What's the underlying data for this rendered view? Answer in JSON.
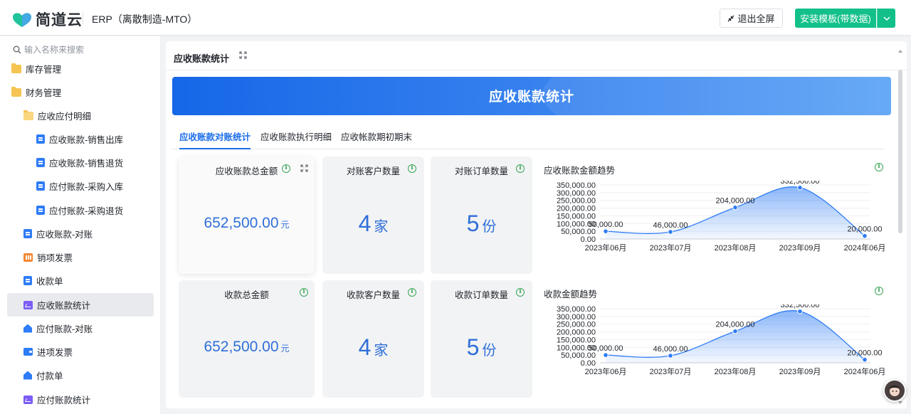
{
  "header": {
    "logo_text": "简道云",
    "app_title": "ERP（离散制造-MTO）",
    "exit_fullscreen": "退出全屏",
    "install_template": "安装模板(带数据)"
  },
  "sidebar": {
    "search_placeholder": "输入名称来搜索",
    "items": [
      {
        "label": "库存管理",
        "icon": "folder-icon"
      },
      {
        "label": "财务管理",
        "icon": "folder-open-icon"
      },
      {
        "label": "应收应付明细",
        "icon": "folder-open-icon"
      },
      {
        "label": "应收账款-销售出库",
        "icon": "form-icon"
      },
      {
        "label": "应收账款-销售退货",
        "icon": "form-icon"
      },
      {
        "label": "应付账款-采购入库",
        "icon": "form-icon"
      },
      {
        "label": "应付账款-采购退货",
        "icon": "form-icon"
      },
      {
        "label": "应收账款-对账",
        "icon": "form-icon"
      },
      {
        "label": "销项发票",
        "icon": "invoice-icon"
      },
      {
        "label": "收款单",
        "icon": "form-icon"
      },
      {
        "label": "应收账款统计",
        "icon": "chart-icon"
      },
      {
        "label": "应付账款-对账",
        "icon": "home-icon"
      },
      {
        "label": "进项发票",
        "icon": "wallet-icon"
      },
      {
        "label": "付款单",
        "icon": "home-icon"
      },
      {
        "label": "应付账款统计",
        "icon": "chart-icon"
      }
    ]
  },
  "main": {
    "title": "应收账款统计",
    "banner_title": "应收账款统计",
    "tabs": [
      "应收账款对账统计",
      "应收账款执行明细",
      "应收帐款期初期末"
    ],
    "kpis": [
      {
        "title": "应收账款总金额",
        "value": "652,500.00",
        "unit": "元"
      },
      {
        "title": "对账客户数量",
        "value": "4",
        "unit": "家"
      },
      {
        "title": "对账订单数量",
        "value": "5",
        "unit": "份"
      },
      {
        "title": "收款总金额",
        "value": "652,500.00",
        "unit": "元"
      },
      {
        "title": "收款客户数量",
        "value": "4",
        "unit": "家"
      },
      {
        "title": "收款订单数量",
        "value": "5",
        "unit": "份"
      }
    ]
  },
  "chart_data": [
    {
      "type": "area",
      "title": "应收账款金额趋势",
      "categories": [
        "2023年06月",
        "2023年07月",
        "2023年08月",
        "2023年09月",
        "2024年06月"
      ],
      "values": [
        50000,
        46000,
        204000,
        332500,
        20000
      ],
      "labels": [
        "50,000.00",
        "46,000.00",
        "204,000.00",
        "332,500.00",
        "20,000.00"
      ],
      "yticks": [
        "0.00",
        "50,000.00",
        "100,000.00",
        "150,000.00",
        "200,000.00",
        "250,000.00",
        "300,000.00",
        "350,000.00"
      ],
      "ylim": [
        0,
        350000
      ],
      "color": "#2e7cf6"
    },
    {
      "type": "area",
      "title": "收款金额趋势",
      "categories": [
        "2023年06月",
        "2023年07月",
        "2023年08月",
        "2023年09月",
        "2024年06月"
      ],
      "values": [
        50000,
        46000,
        204000,
        332500,
        20000
      ],
      "labels": [
        "50,000.00",
        "46,000.00",
        "204,000.00",
        "332,500.00",
        "20,000.00"
      ],
      "yticks": [
        "0.00",
        "50,000.00",
        "100,000.00",
        "150,000.00",
        "200,000.00",
        "250,000.00",
        "300,000.00",
        "350,000.00"
      ],
      "ylim": [
        0,
        350000
      ],
      "color": "#2e7cf6"
    }
  ]
}
